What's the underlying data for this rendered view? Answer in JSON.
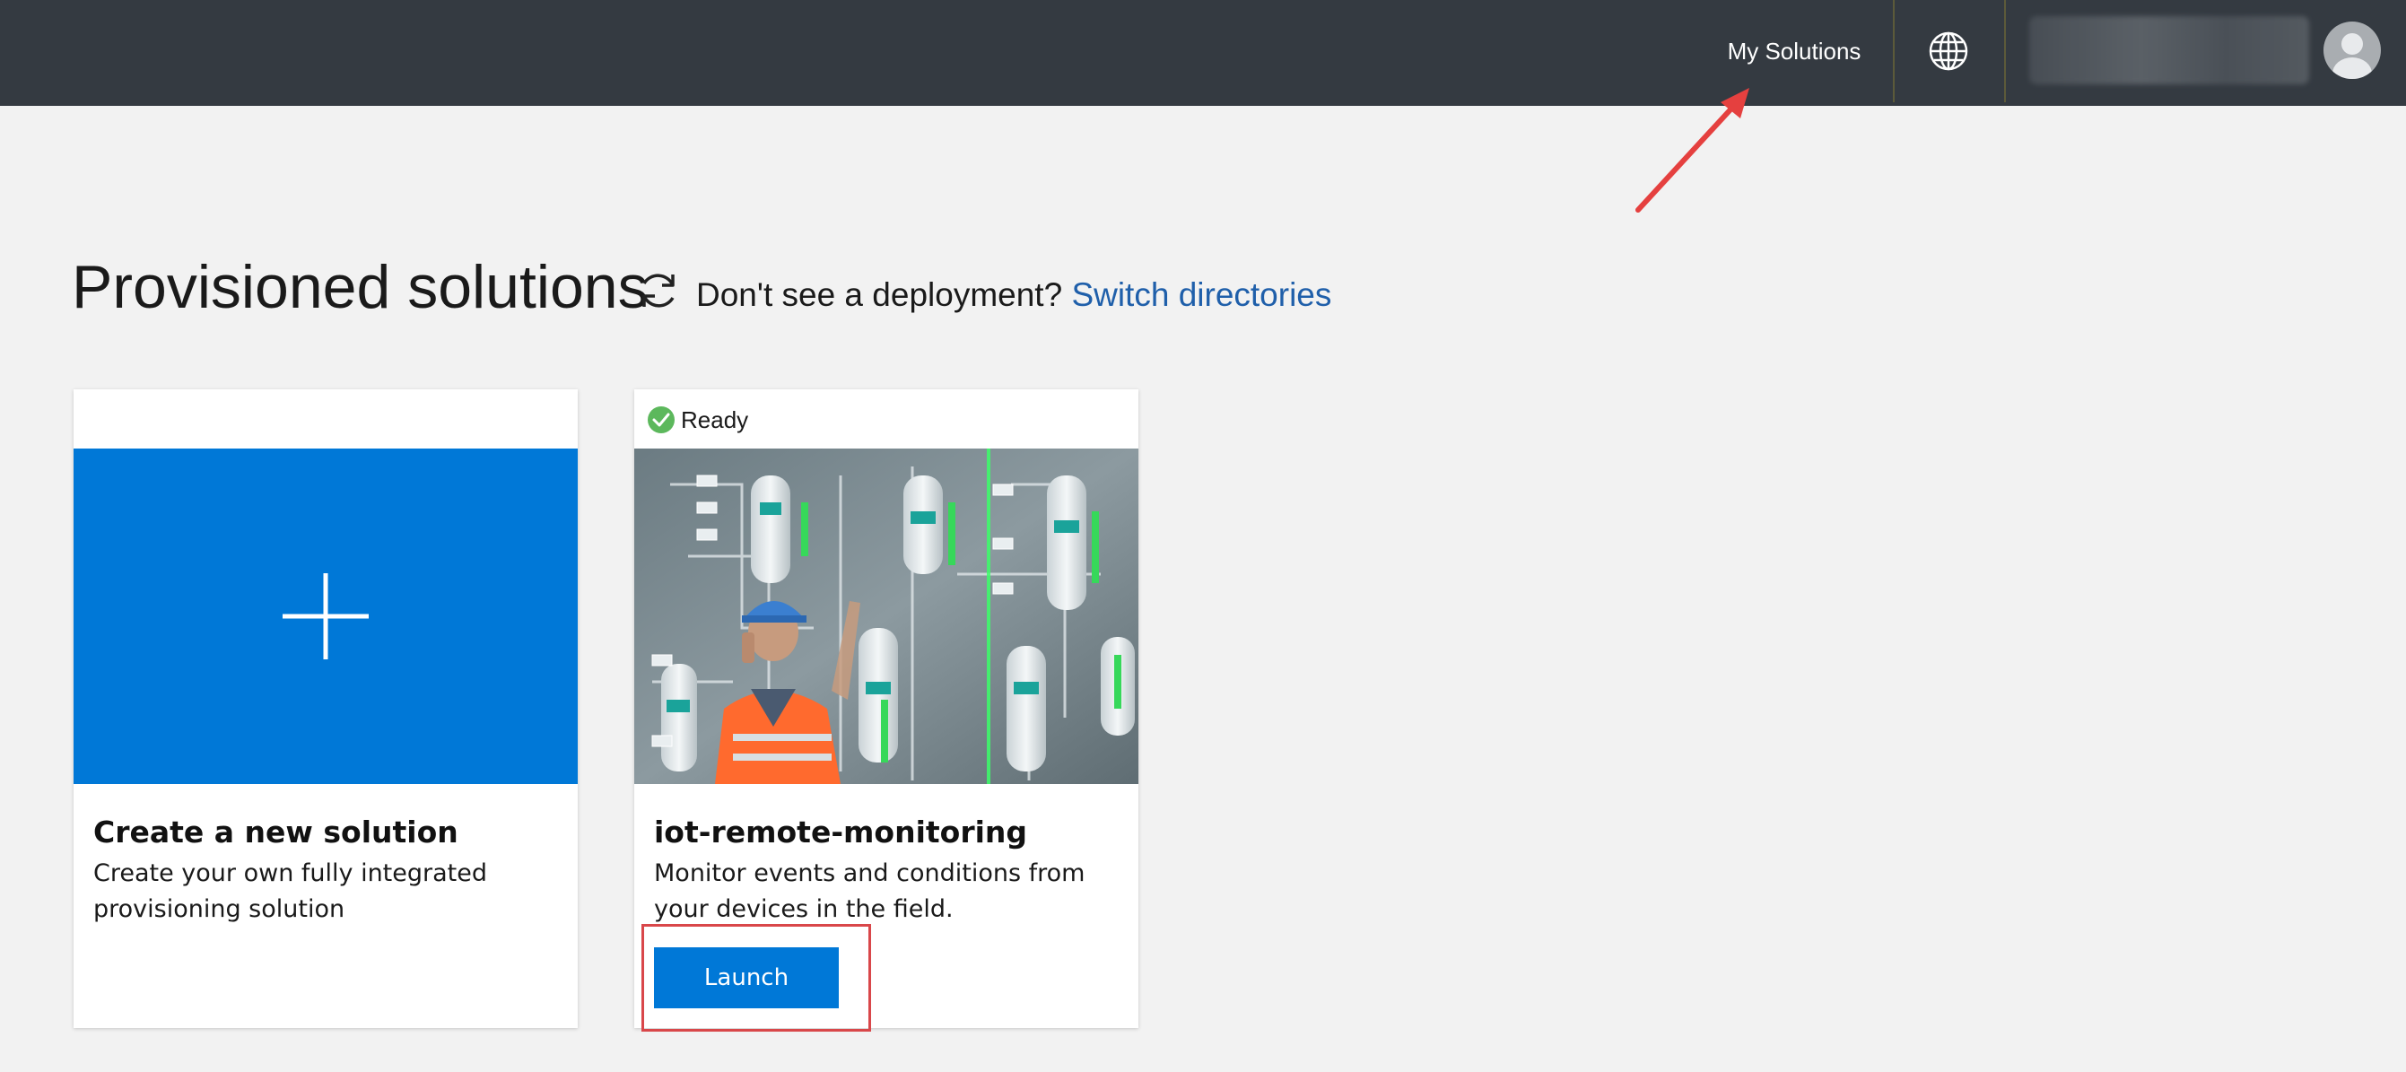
{
  "topbar": {
    "my_solutions_label": "My Solutions",
    "globe_icon": "globe-icon",
    "avatar_icon": "user-avatar-icon",
    "background": "#343a41"
  },
  "header": {
    "title": "Provisioned solutions",
    "refresh_icon": "refresh-icon",
    "hint_text": "Don't see a deployment?",
    "switch_link": "Switch directories"
  },
  "cards": [
    {
      "title": "Create a new solution",
      "description": "Create your own fully integrated provisioning solution",
      "tile_color": "#0078d7",
      "icon": "plus-icon"
    },
    {
      "status": "Ready",
      "status_icon": "check-circle-icon",
      "status_color": "#5cb85c",
      "title": "iot-remote-monitoring",
      "description": "Monitor events and conditions from your devices in the field.",
      "launch_label": "Launch",
      "button_color": "#0078d7"
    }
  ],
  "annotations": {
    "highlight_color": "#d9474a"
  }
}
